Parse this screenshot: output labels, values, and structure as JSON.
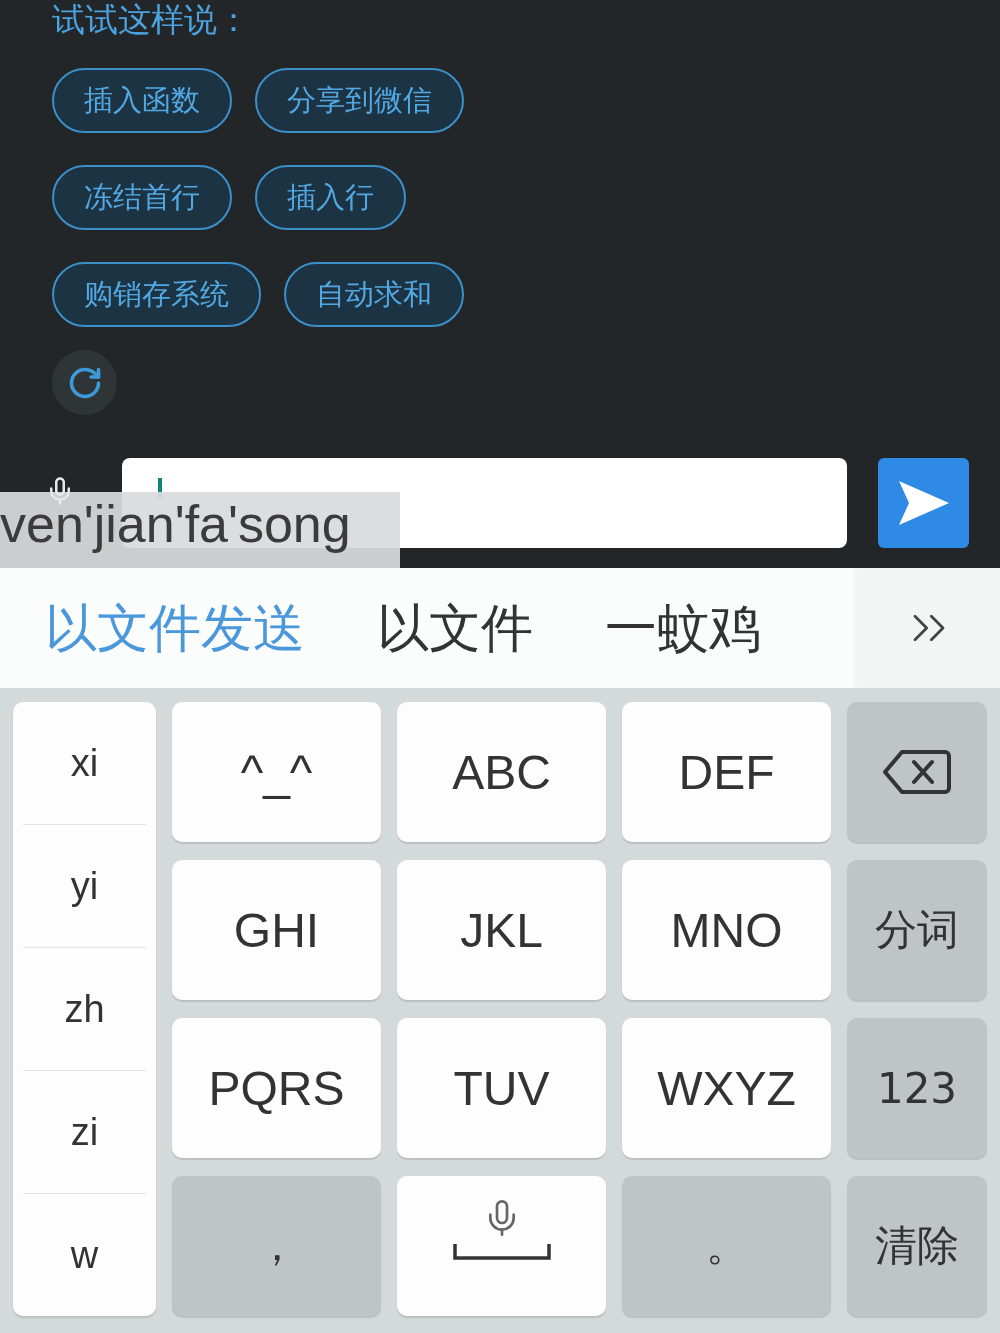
{
  "prompt": {
    "title": "试试这样说："
  },
  "suggestion_rows": [
    [
      "插入函数",
      "分享到微信"
    ],
    [
      "冻结首行",
      "插入行"
    ],
    [
      "购销存系统",
      "自动求和"
    ]
  ],
  "input": {
    "focused": true
  },
  "composition": {
    "text": "ven'jian'fa'song"
  },
  "candidates": [
    {
      "label": "以文件发送",
      "selected": true
    },
    {
      "label": "以文件",
      "selected": false
    },
    {
      "label": "一蚊鸡",
      "selected": false
    }
  ],
  "pinyin_options": [
    "xi",
    "yi",
    "zh",
    "zi",
    "w"
  ],
  "keys": [
    [
      {
        "kind": "char",
        "label": "^_^"
      },
      {
        "kind": "char",
        "label": "ABC"
      },
      {
        "kind": "char",
        "label": "DEF"
      },
      {
        "kind": "backspace"
      }
    ],
    [
      {
        "kind": "char",
        "label": "GHI"
      },
      {
        "kind": "char",
        "label": "JKL"
      },
      {
        "kind": "char",
        "label": "MNO"
      },
      {
        "kind": "func",
        "label": "分词"
      }
    ],
    [
      {
        "kind": "char",
        "label": "PQRS"
      },
      {
        "kind": "char",
        "label": "TUV"
      },
      {
        "kind": "char",
        "label": "WXYZ"
      },
      {
        "kind": "func",
        "label": "123"
      }
    ],
    [
      {
        "kind": "func",
        "label": "，"
      },
      {
        "kind": "space"
      },
      {
        "kind": "func",
        "label": "。"
      },
      {
        "kind": "func",
        "label": "清除"
      }
    ]
  ]
}
